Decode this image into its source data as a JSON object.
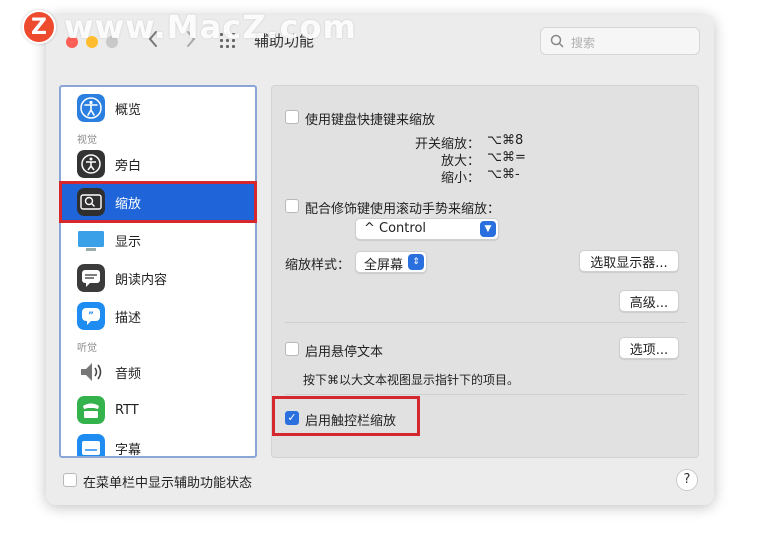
{
  "watermark": {
    "badge": "Z",
    "text": "www.MacZ.com"
  },
  "window": {
    "title": "辅助功能"
  },
  "search": {
    "placeholder": "搜索"
  },
  "sidebar": {
    "items": [
      {
        "label": "概览",
        "icon": "accessibility-icon"
      },
      {
        "section": "视觉"
      },
      {
        "label": "旁白",
        "icon": "voiceover-icon"
      },
      {
        "label": "缩放",
        "icon": "zoom-icon",
        "selected": true
      },
      {
        "label": "显示",
        "icon": "display-icon"
      },
      {
        "label": "朗读内容",
        "icon": "speech-icon"
      },
      {
        "label": "描述",
        "icon": "descriptions-icon"
      },
      {
        "section": "听觉"
      },
      {
        "label": "音频",
        "icon": "speaker-icon"
      },
      {
        "label": "RTT",
        "icon": "rtt-icon"
      },
      {
        "label": "字幕",
        "icon": "captions-icon"
      }
    ]
  },
  "zoom": {
    "keyboard_shortcuts_label": "使用键盘快捷键来缩放",
    "shortcuts": [
      {
        "name": "开关缩放：",
        "keys": "⌥⌘8"
      },
      {
        "name": "放大：",
        "keys": "⌥⌘="
      },
      {
        "name": "缩小：",
        "keys": "⌥⌘-"
      }
    ],
    "scroll_gesture_label": "配合修饰键使用滚动手势来缩放：",
    "modifier_value": "^ Control",
    "style_label": "缩放样式：",
    "style_value": "全屏幕",
    "choose_display_button": "选取显示器...",
    "advanced_button": "高级...",
    "hover_text_label": "启用悬停文本",
    "options_button": "选项...",
    "hover_text_hint": "按下⌘以大文本视图显示指针下的项目。",
    "touchbar_zoom_label": "启用触控栏缩放",
    "touchbar_zoom_checked": true
  },
  "footer": {
    "show_in_menubar_label": "在菜单栏中显示辅助功能状态",
    "help_label": "?"
  },
  "colors": {
    "accent": "#2a6fde",
    "highlight": "#d6262e"
  }
}
